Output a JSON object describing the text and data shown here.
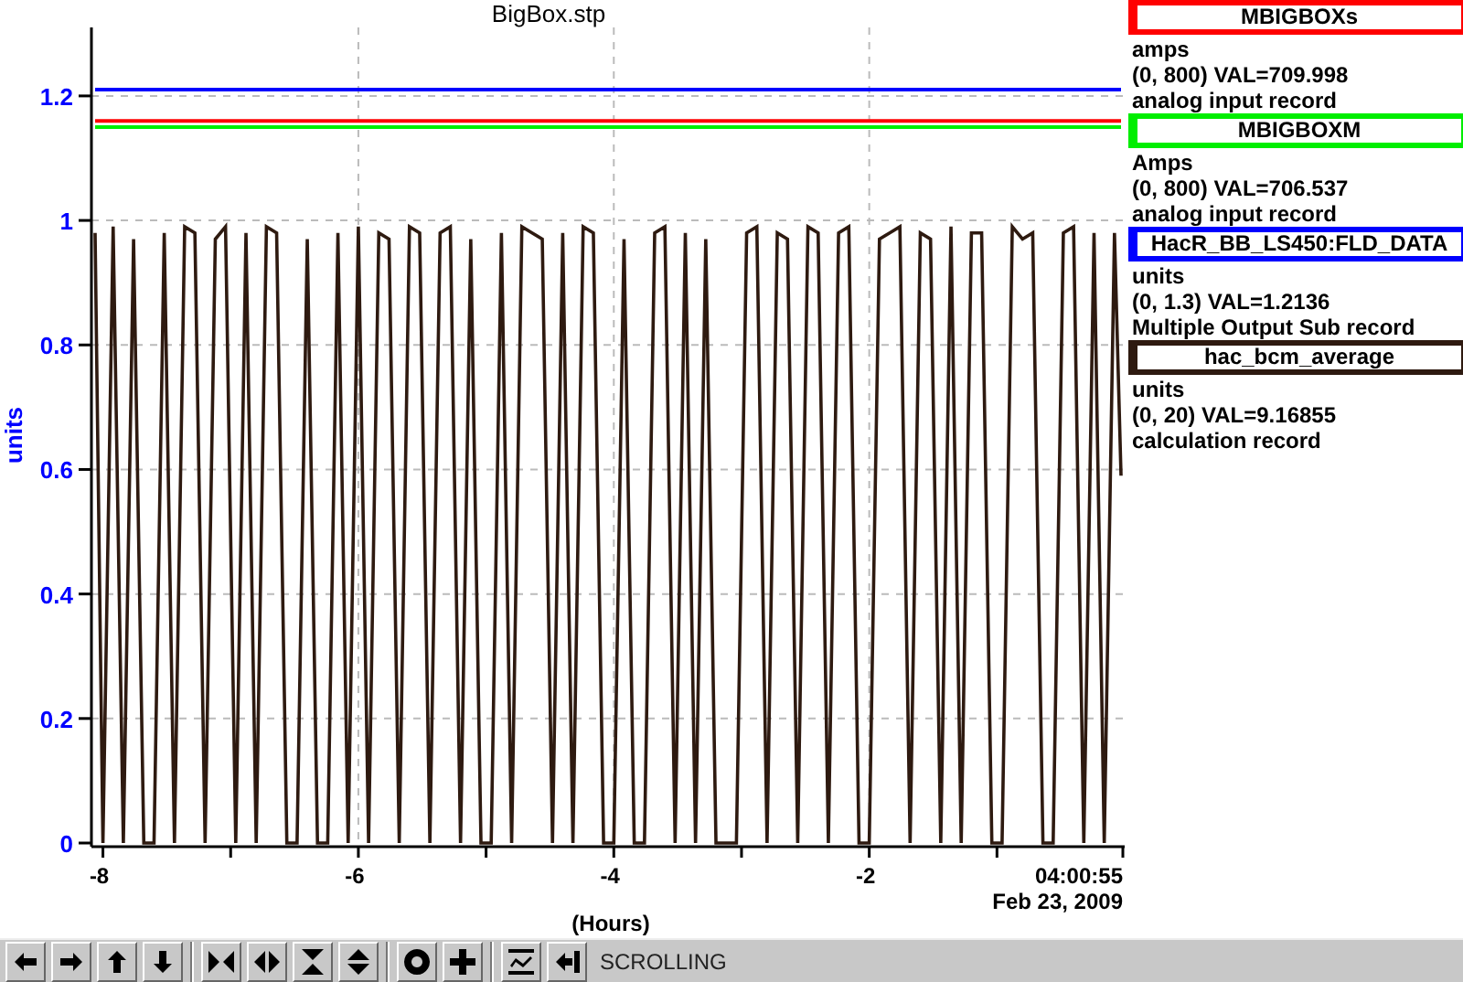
{
  "window": {
    "title": "BigBox.stp"
  },
  "chart": {
    "chart_data": {
      "type": "line",
      "xlabel": "(Hours)",
      "ylabel": "units",
      "x": [
        -8.08,
        -8.0,
        -7.92,
        -7.84,
        -7.76,
        -7.68,
        -7.6,
        -7.52,
        -7.44,
        -7.36,
        -7.28,
        -7.2,
        -7.12,
        -7.04,
        -6.96,
        -6.88,
        -6.8,
        -6.72,
        -6.64,
        -6.56,
        -6.48,
        -6.4,
        -6.32,
        -6.24,
        -6.16,
        -6.08,
        -6.0,
        -5.92,
        -5.84,
        -5.76,
        -5.68,
        -5.6,
        -5.52,
        -5.44,
        -5.36,
        -5.28,
        -5.2,
        -5.12,
        -5.04,
        -4.96,
        -4.88,
        -4.8,
        -4.72,
        -4.64,
        -4.56,
        -4.48,
        -4.4,
        -4.32,
        -4.24,
        -4.16,
        -4.08,
        -4.0,
        -3.92,
        -3.84,
        -3.76,
        -3.68,
        -3.6,
        -3.52,
        -3.44,
        -3.36,
        -3.28,
        -3.2,
        -3.12,
        -3.04,
        -2.96,
        -2.88,
        -2.8,
        -2.72,
        -2.64,
        -2.56,
        -2.48,
        -2.4,
        -2.32,
        -2.24,
        -2.16,
        -2.08,
        -2.0,
        -1.92,
        -1.84,
        -1.76,
        -1.68,
        -1.6,
        -1.52,
        -1.44,
        -1.36,
        -1.28,
        -1.2,
        -1.12,
        -1.04,
        -0.96,
        -0.88,
        -0.8,
        -0.72,
        -0.64,
        -0.56,
        -0.48,
        -0.4,
        -0.32,
        -0.24,
        -0.16,
        -0.08,
        0
      ],
      "xlim": [
        -8.09,
        0
      ],
      "ylim": [
        0,
        1.31
      ],
      "xticks": [
        -8,
        -6,
        -4,
        -2
      ],
      "grid": true,
      "yticks": [
        0,
        0.2,
        0.4,
        0.6,
        0.8,
        1,
        1.2
      ],
      "series": [
        {
          "color": "#2e1a10",
          "values": [
            0.98,
            0,
            0.99,
            0,
            0.97,
            0,
            0,
            0.98,
            0,
            0.99,
            0.98,
            0,
            0.97,
            0.99,
            0,
            0.98,
            0,
            0.99,
            0.98,
            0,
            0,
            0.97,
            0,
            0,
            0.98,
            0,
            0.99,
            0,
            0.98,
            0.97,
            0,
            0.99,
            0.98,
            0,
            0.98,
            0.99,
            0,
            0.97,
            0,
            0,
            0.98,
            0,
            0.99,
            0.98,
            0.97,
            0,
            0.98,
            0,
            0.99,
            0.98,
            0,
            0,
            0.97,
            0,
            0,
            0.98,
            0.99,
            0,
            0.98,
            0,
            0.97,
            0,
            0,
            0,
            0.98,
            0.99,
            0,
            0.98,
            0.97,
            0,
            0.99,
            0.98,
            0,
            0.98,
            0.99,
            0,
            0,
            0.97,
            0.98,
            0.99,
            0,
            0.98,
            0.97,
            0,
            0.99,
            0,
            0.98,
            0.98,
            0,
            0,
            0.99,
            0.97,
            0.98,
            0,
            0,
            0.98,
            0.99,
            0,
            0.98,
            0,
            0.98,
            0.59
          ]
        },
        {
          "color": "#0000ff",
          "values": [
            1.21,
            1.21,
            1.21,
            1.21,
            1.21,
            1.21,
            1.21,
            1.21,
            1.21,
            1.21,
            1.21,
            1.21,
            1.21,
            1.21,
            1.21,
            1.21,
            1.21,
            1.21,
            1.21,
            1.21,
            1.21,
            1.21,
            1.21,
            1.21,
            1.21,
            1.21,
            1.21,
            1.21,
            1.21,
            1.21,
            1.21,
            1.21,
            1.21,
            1.21,
            1.21,
            1.21,
            1.21,
            1.21,
            1.21,
            1.21,
            1.21,
            1.21,
            1.21,
            1.21,
            1.21,
            1.21,
            1.21,
            1.21,
            1.21,
            1.21,
            1.21,
            1.21,
            1.21,
            1.21,
            1.21,
            1.21,
            1.21,
            1.21,
            1.21,
            1.21,
            1.21,
            1.21,
            1.21,
            1.21,
            1.21,
            1.21,
            1.21,
            1.21,
            1.21,
            1.21,
            1.21,
            1.21,
            1.21,
            1.21,
            1.21,
            1.21,
            1.21,
            1.21,
            1.21,
            1.21,
            1.21,
            1.21,
            1.21,
            1.21,
            1.21,
            1.21,
            1.21,
            1.21,
            1.21,
            1.21,
            1.21,
            1.21,
            1.21,
            1.21,
            1.21,
            1.21,
            1.21,
            1.21,
            1.21,
            1.21,
            1.21,
            1.21
          ]
        },
        {
          "color": "#ff0000",
          "values": [
            1.16,
            1.16,
            1.16,
            1.16,
            1.16,
            1.16,
            1.16,
            1.16,
            1.16,
            1.16,
            1.16,
            1.16,
            1.16,
            1.16,
            1.16,
            1.16,
            1.16,
            1.16,
            1.16,
            1.16,
            1.16,
            1.16,
            1.16,
            1.16,
            1.16,
            1.16,
            1.16,
            1.16,
            1.16,
            1.16,
            1.16,
            1.16,
            1.16,
            1.16,
            1.16,
            1.16,
            1.16,
            1.16,
            1.16,
            1.16,
            1.16,
            1.16,
            1.16,
            1.16,
            1.16,
            1.16,
            1.16,
            1.16,
            1.16,
            1.16,
            1.16,
            1.16,
            1.16,
            1.16,
            1.16,
            1.16,
            1.16,
            1.16,
            1.16,
            1.16,
            1.16,
            1.16,
            1.16,
            1.16,
            1.16,
            1.16,
            1.16,
            1.16,
            1.16,
            1.16,
            1.16,
            1.16,
            1.16,
            1.16,
            1.16,
            1.16,
            1.16,
            1.16,
            1.16,
            1.16,
            1.16,
            1.16,
            1.16,
            1.16,
            1.16,
            1.16,
            1.16,
            1.16,
            1.16,
            1.16,
            1.16,
            1.16,
            1.16,
            1.16,
            1.16,
            1.16,
            1.16,
            1.16,
            1.16,
            1.16,
            1.16,
            1.16
          ]
        },
        {
          "color": "#00ee00",
          "values": [
            1.15,
            1.15,
            1.15,
            1.15,
            1.15,
            1.15,
            1.15,
            1.15,
            1.15,
            1.15,
            1.15,
            1.15,
            1.15,
            1.15,
            1.15,
            1.15,
            1.15,
            1.15,
            1.15,
            1.15,
            1.15,
            1.15,
            1.15,
            1.15,
            1.15,
            1.15,
            1.15,
            1.15,
            1.15,
            1.15,
            1.15,
            1.15,
            1.15,
            1.15,
            1.15,
            1.15,
            1.15,
            1.15,
            1.15,
            1.15,
            1.15,
            1.15,
            1.15,
            1.15,
            1.15,
            1.15,
            1.15,
            1.15,
            1.15,
            1.15,
            1.15,
            1.15,
            1.15,
            1.15,
            1.15,
            1.15,
            1.15,
            1.15,
            1.15,
            1.15,
            1.15,
            1.15,
            1.15,
            1.15,
            1.15,
            1.15,
            1.15,
            1.15,
            1.15,
            1.15,
            1.15,
            1.15,
            1.15,
            1.15,
            1.15,
            1.15,
            1.15,
            1.15,
            1.15,
            1.15,
            1.15,
            1.15,
            1.15,
            1.15,
            1.15,
            1.15,
            1.15,
            1.15,
            1.15,
            1.15,
            1.15,
            1.15,
            1.15,
            1.15,
            1.15,
            1.15,
            1.15,
            1.15,
            1.15,
            1.15,
            1.15,
            1.15
          ]
        }
      ]
    },
    "time_label": "04:00:55",
    "date_label": "Feb 23, 2009"
  },
  "legend": [
    {
      "name": "MBIGBOXs",
      "color": "#ff0000",
      "units": "amps",
      "range_value": "(0, 800) VAL=709.998",
      "record_type": "analog input record"
    },
    {
      "name": "MBIGBOXM",
      "color": "#00ee00",
      "units": "Amps",
      "range_value": "(0, 800) VAL=706.537",
      "record_type": "analog input record"
    },
    {
      "name": "HacR_BB_LS450:FLD_DATA",
      "color": "#0000ff",
      "units": "units",
      "range_value": "(0, 1.3) VAL=1.2136",
      "record_type": "Multiple Output Sub record"
    },
    {
      "name": "hac_bcm_average",
      "color": "#2e1a10",
      "units": "units",
      "range_value": "(0, 20) VAL=9.16855",
      "record_type": "calculation record"
    }
  ],
  "toolbar": {
    "groups": [
      [
        {
          "kind": "left"
        },
        {
          "kind": "right"
        },
        {
          "kind": "up"
        },
        {
          "kind": "down"
        }
      ],
      [
        {
          "kind": "zoom-in-h"
        },
        {
          "kind": "zoom-out-h"
        },
        {
          "kind": "zoom-in-v"
        },
        {
          "kind": "zoom-out-v"
        }
      ],
      [
        {
          "kind": "circle"
        },
        {
          "kind": "plus"
        }
      ],
      [
        {
          "kind": "graph"
        },
        {
          "kind": "back"
        }
      ]
    ],
    "status": "SCROLLING"
  }
}
